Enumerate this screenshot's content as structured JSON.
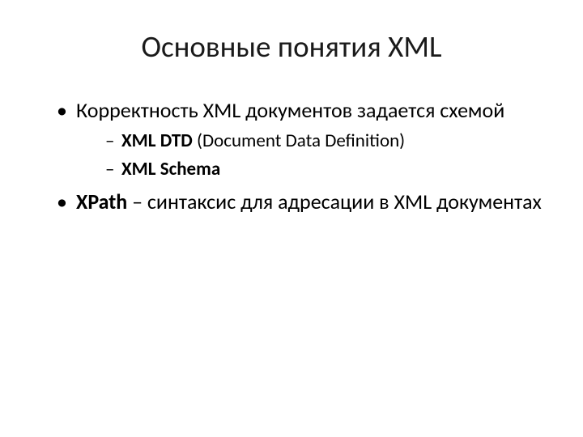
{
  "title": "Основные понятия XML",
  "bullets": {
    "item1": {
      "text": "Корректность XML документов задается схемой",
      "sub1_bold": "XML DTD",
      "sub1_rest": " (Document Data Definition)",
      "sub2_bold": "XML Schema"
    },
    "item2": {
      "bold": "XPath",
      "rest": " – синтаксис для адресации в XML документах"
    }
  }
}
